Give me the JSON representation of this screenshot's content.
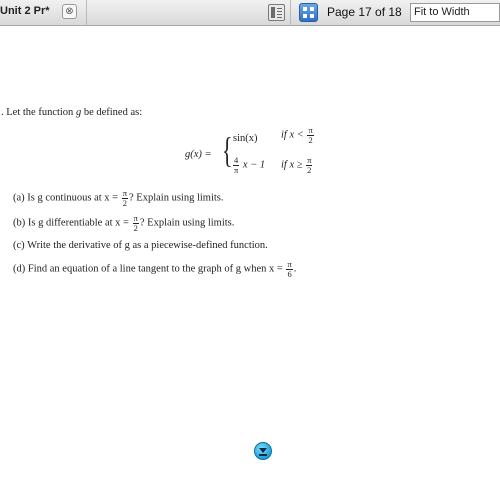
{
  "toolbar": {
    "doc_title": "Unit 2 Pr*",
    "close_symbol": "⊗",
    "sidebar_icon": "sidebar-toggle-icon",
    "grid_icon": "thumbnail-grid-icon",
    "page_label": "Page 17 of 18",
    "zoom_value": "Fit to Width"
  },
  "problem": {
    "number_fragment": ".",
    "intro": "Let the function",
    "intro_var": "g",
    "intro_rest": "be defined as:",
    "definition": {
      "lhs": "g(x) =",
      "case1_expr": "sin(x)",
      "case1_cond_prefix": "if x <",
      "case1_cond_num": "π",
      "case1_cond_den": "2",
      "case2_coef_num": "4",
      "case2_coef_den": "π",
      "case2_expr_rest": "x − 1",
      "case2_cond_prefix": "if x ≥",
      "case2_cond_num": "π",
      "case2_cond_den": "2"
    },
    "parts": [
      {
        "label": "(a)",
        "text_before": "Is g continuous at x =",
        "frac_num": "π",
        "frac_den": "2",
        "text_after": "? Explain using limits."
      },
      {
        "label": "(b)",
        "text_before": "Is g differentiable at x =",
        "frac_num": "π",
        "frac_den": "2",
        "text_after": "? Explain using limits."
      },
      {
        "label": "(c)",
        "text_before": "Write the derivative of g as a piecewise-defined function."
      },
      {
        "label": "(d)",
        "text_before": "Find an equation of a line tangent to the graph of g when x =",
        "frac_num": "π",
        "frac_den": "6",
        "text_after": "."
      }
    ]
  },
  "scroll_button_icon": "scroll-down-icon"
}
